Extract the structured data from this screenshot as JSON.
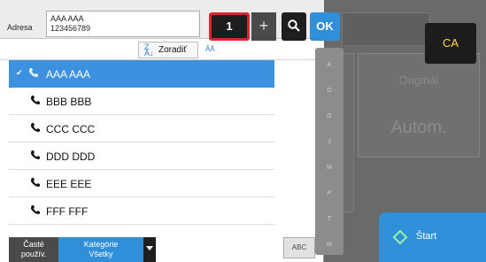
{
  "background": {
    "mode_label": "Originál",
    "mode_value": "Autom."
  },
  "ca_button": "CA",
  "start_button": "Štart",
  "header": {
    "address_label": "Adresa",
    "address_line1": "AAA AAA",
    "address_line2": "123456789",
    "count_value": "1",
    "plus_label": "+",
    "ok_label": "OK"
  },
  "sort": {
    "sort_label": "Zoradiť",
    "view_label": "ĀĀ"
  },
  "contacts": [
    {
      "name": "AAA AAA",
      "selected": true
    },
    {
      "name": "BBB BBB",
      "selected": false
    },
    {
      "name": "CCC CCC",
      "selected": false
    },
    {
      "name": "DDD DDD",
      "selected": false
    },
    {
      "name": "EEE EEE",
      "selected": false
    },
    {
      "name": "FFF FFF",
      "selected": false
    }
  ],
  "index_letters": [
    "A",
    "D",
    "G",
    "J",
    "M",
    "P",
    "T",
    "W"
  ],
  "abc_label": "ABC",
  "bottom_tabs": {
    "frequent_line1": "Časté",
    "frequent_line2": "použív.",
    "category_line1": "Kategórie",
    "category_line2": "Všetky"
  },
  "colors": {
    "accent": "#2f8fd8",
    "highlight_border": "#e0232d",
    "ca_text": "#ffd84a"
  }
}
